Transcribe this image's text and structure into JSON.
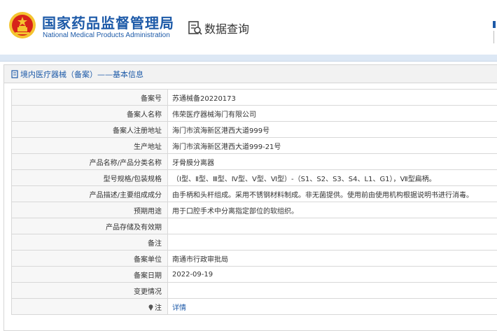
{
  "header": {
    "org_name_cn": "国家药品监督管理局",
    "org_name_en": "National Medical Products Administration",
    "query_title": "数据查询",
    "emblem_icon": "national-emblem-icon",
    "query_icon": "document-search-icon"
  },
  "section": {
    "title": "境内医疗器械（备案）——基本信息",
    "title_icon": "document-icon"
  },
  "rows": [
    {
      "label": "备案号",
      "value": "苏通械备20220173"
    },
    {
      "label": "备案人名称",
      "value": "伟荣医疗器械海门有限公司"
    },
    {
      "label": "备案人注册地址",
      "value": "海门市滨海新区港西大道999号"
    },
    {
      "label": "生产地址",
      "value": "海门市滨海新区港西大道999-21号"
    },
    {
      "label": "产品名称/产品分类名称",
      "value": "牙骨膜分离器"
    },
    {
      "label": "型号规格/包装规格",
      "value": "（Ⅰ型、Ⅱ型、Ⅲ型、Ⅳ型、Ⅴ型、Ⅵ型）-（S1、S2、S3、S4、L1、G1），Ⅶ型扁柄。"
    },
    {
      "label": "产品描述/主要组成成分",
      "value": "由手柄和头杆组成。采用不锈钢材料制成。非无菌提供。使用前由使用机构根据说明书进行消毒。"
    },
    {
      "label": "预期用途",
      "value": "用于口腔手术中分离指定部位的软组织。"
    },
    {
      "label": "产品存储及有效期",
      "value": ""
    },
    {
      "label": "备注",
      "value": ""
    },
    {
      "label": "备案单位",
      "value": "南通市行政审批局"
    },
    {
      "label": "备案日期",
      "value": "2022-09-19"
    },
    {
      "label": "变更情况",
      "value": ""
    },
    {
      "label": "注",
      "value": "详情",
      "label_icon": "pin-icon"
    }
  ],
  "colors": {
    "brand_blue": "#1d5aa8",
    "emblem_red": "#d7231a",
    "emblem_gold": "#f4c430",
    "label_bg": "#f7f7f7",
    "border": "#d8d8d8"
  }
}
